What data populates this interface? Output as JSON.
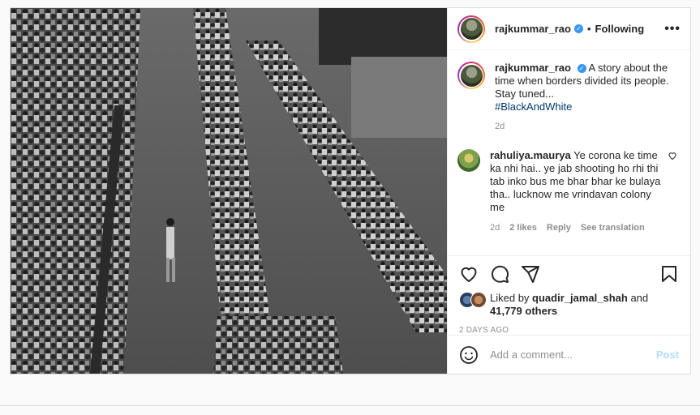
{
  "post": {
    "username": "rajkummar_rao",
    "verified": true,
    "separator": "•",
    "follow_status": "Following",
    "more_label": "•••",
    "caption": {
      "username": "rajkummar_rao",
      "text": "A story about the time when borders divided its people. Stay tuned...",
      "hashtag": "#BlackAndWhite",
      "age": "2d"
    },
    "comments": [
      {
        "username": "rahuliya.maurya",
        "text": "Ye corona ke time ka nhi hai.. ye jab shooting ho rhi thi tab inko bus me bhar bhar ke bulaya tha.. lucknow me vrindavan colony me",
        "age": "2d",
        "likes": "2 likes",
        "reply": "Reply",
        "translate": "See translation"
      }
    ],
    "liked_by": {
      "prefix": "Liked by",
      "user": "quadir_jamal_shah",
      "conjunction": "and",
      "others": "41,779 others"
    },
    "date": "2 DAYS AGO",
    "add_comment_placeholder": "Add a comment...",
    "post_button": "Post"
  },
  "icons": {
    "like": "heart-icon",
    "comment": "comment-icon",
    "share": "share-icon",
    "save": "bookmark-icon",
    "emoji": "emoji-icon",
    "verified": "verified-badge-icon",
    "comment_like": "heart-icon"
  },
  "colors": {
    "link": "#00376b",
    "verified": "#3897f0",
    "muted": "#8e8e8e",
    "post_disabled": "#b2dffc"
  }
}
